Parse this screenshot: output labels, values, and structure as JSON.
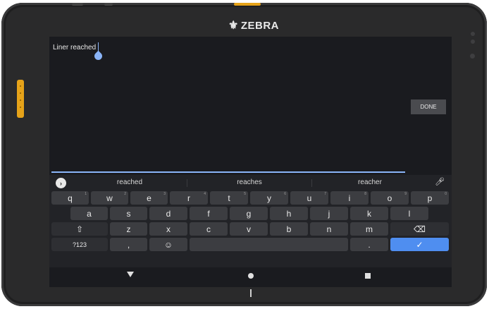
{
  "device": {
    "brand": "ZEBRA"
  },
  "editor": {
    "text": "Liner reached"
  },
  "done_label": "DONE",
  "suggestions": [
    "reached",
    "reaches",
    "reacher"
  ],
  "keyboard": {
    "row1": [
      {
        "label": "q",
        "hint": "1"
      },
      {
        "label": "w",
        "hint": "2"
      },
      {
        "label": "e",
        "hint": "3"
      },
      {
        "label": "r",
        "hint": "4"
      },
      {
        "label": "t",
        "hint": "5"
      },
      {
        "label": "y",
        "hint": "6"
      },
      {
        "label": "u",
        "hint": "7"
      },
      {
        "label": "i",
        "hint": "8"
      },
      {
        "label": "o",
        "hint": "9"
      },
      {
        "label": "p",
        "hint": "0"
      }
    ],
    "row2": [
      "a",
      "s",
      "d",
      "f",
      "g",
      "h",
      "j",
      "k",
      "l"
    ],
    "row3": [
      "z",
      "x",
      "c",
      "v",
      "b",
      "n",
      "m"
    ],
    "symbols_label": "?123",
    "comma_label": ",",
    "period_label": "."
  },
  "colors": {
    "accent": "#8ab4f8",
    "enter": "#4f8ef0",
    "side_button": "#e6a319"
  },
  "icons": {
    "expand": "chevron-right-icon",
    "mic": "microphone-icon",
    "shift": "shift-icon",
    "backspace": "backspace-icon",
    "emoji": "emoji-icon",
    "enter": "check-icon",
    "nav_back": "back-triangle-icon",
    "nav_home": "home-circle-icon",
    "nav_recent": "recents-square-icon"
  }
}
